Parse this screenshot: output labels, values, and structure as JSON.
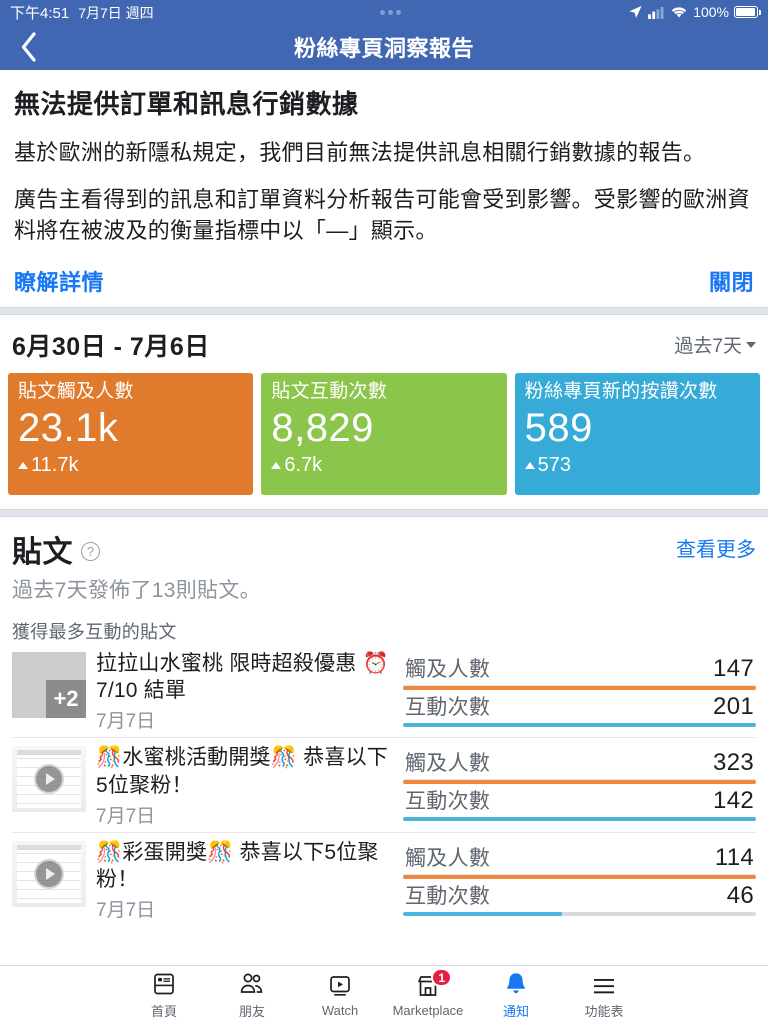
{
  "status_bar": {
    "time": "下午4:51",
    "date": "7月7日 週四",
    "battery_pct": "100%",
    "icons": [
      "location-arrow-icon",
      "cellular-signal-icon",
      "wifi-icon",
      "battery-icon"
    ]
  },
  "nav": {
    "back_icon": "chevron-left-icon",
    "title": "粉絲專頁洞察報告"
  },
  "notice": {
    "title": "無法提供訂單和訊息行銷數據",
    "paragraph1": "基於歐洲的新隱私規定，我們目前無法提供訊息相關行銷數據的報告。",
    "paragraph2": "廣告主看得到的訊息和訂單資料分析報告可能會受到影響。受影響的歐洲資料將在被波及的衡量指標中以「—」顯示。",
    "learn_more": "瞭解詳情",
    "close": "關閉"
  },
  "summary": {
    "date_range": "6月30日 - 7月6日",
    "range_picker": "過去7天",
    "cards": [
      {
        "label": "貼文觸及人數",
        "value": "23.1k",
        "delta": "11.7k",
        "color": "#E07B2E"
      },
      {
        "label": "貼文互動次數",
        "value": "8,829",
        "delta": "6.7k",
        "color": "#8CC54B"
      },
      {
        "label": "粉絲專頁新的按讚次數",
        "value": "589",
        "delta": "573",
        "color": "#37ABD8"
      }
    ]
  },
  "posts": {
    "title": "貼文",
    "help_icon": "question-mark-circle-icon",
    "see_more": "查看更多",
    "subtitle": "過去7天發佈了13則貼文。",
    "group_label": "獲得最多互動的貼文",
    "metric_labels": {
      "reach": "觸及人數",
      "engagement": "互動次數"
    },
    "bar_colors": {
      "reach": "#F0873D",
      "engagement": "#4BB3DD"
    },
    "items": [
      {
        "thumb_type": "photo",
        "thumb_badge": "+2",
        "title": "拉拉山水蜜桃 限時超殺優惠 ⏰7/10 結單",
        "date": "7月7日",
        "reach_value": "147",
        "reach_fill_pct": 100,
        "engagement_value": "201",
        "engagement_fill_pct": 100
      },
      {
        "thumb_type": "video",
        "thumb_badge": "",
        "title": "🎊水蜜桃活動開獎🎊 恭喜以下5位聚粉！",
        "date": "7月7日",
        "reach_value": "323",
        "reach_fill_pct": 100,
        "engagement_value": "142",
        "engagement_fill_pct": 100
      },
      {
        "thumb_type": "video",
        "thumb_badge": "",
        "title": "🎊彩蛋開獎🎊 恭喜以下5位聚粉！",
        "date": "7月7日",
        "reach_value": "114",
        "reach_fill_pct": 100,
        "engagement_value": "46",
        "engagement_fill_pct": 45
      }
    ]
  },
  "tabbar": {
    "items": [
      {
        "label": "首頁",
        "icon": "news-feed-icon",
        "badge": "",
        "active": false
      },
      {
        "label": "朋友",
        "icon": "friends-icon",
        "badge": "",
        "active": false
      },
      {
        "label": "Watch",
        "icon": "watch-play-icon",
        "badge": "",
        "active": false
      },
      {
        "label": "Marketplace",
        "icon": "marketplace-store-icon",
        "badge": "1",
        "active": false
      },
      {
        "label": "通知",
        "icon": "bell-icon",
        "badge": "",
        "active": true
      },
      {
        "label": "功能表",
        "icon": "hamburger-menu-icon",
        "badge": "",
        "active": false
      }
    ]
  }
}
